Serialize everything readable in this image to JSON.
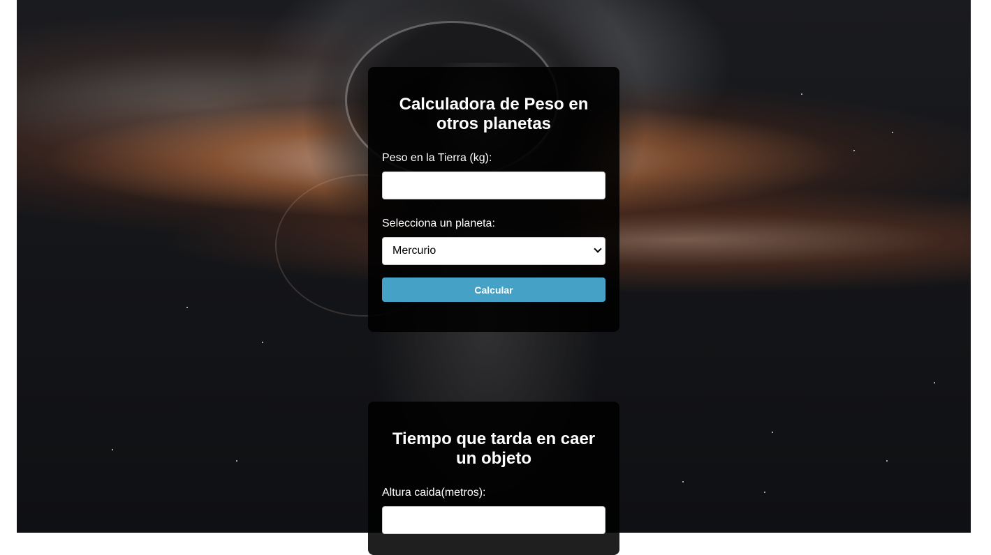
{
  "weight_calculator": {
    "title": "Calculadora de Peso en otros planetas",
    "earth_weight_label": "Peso en la Tierra (kg):",
    "earth_weight_value": "",
    "planet_label": "Selecciona un planeta:",
    "planet_selected": "Mercurio",
    "calculate_label": "Calcular"
  },
  "fall_time": {
    "title": "Tiempo que tarda en caer un objeto",
    "height_label": "Altura caida(metros):",
    "height_value": ""
  },
  "colors": {
    "button": "#45a1c6",
    "card_bg": "rgba(0,0,0,0.88)"
  }
}
